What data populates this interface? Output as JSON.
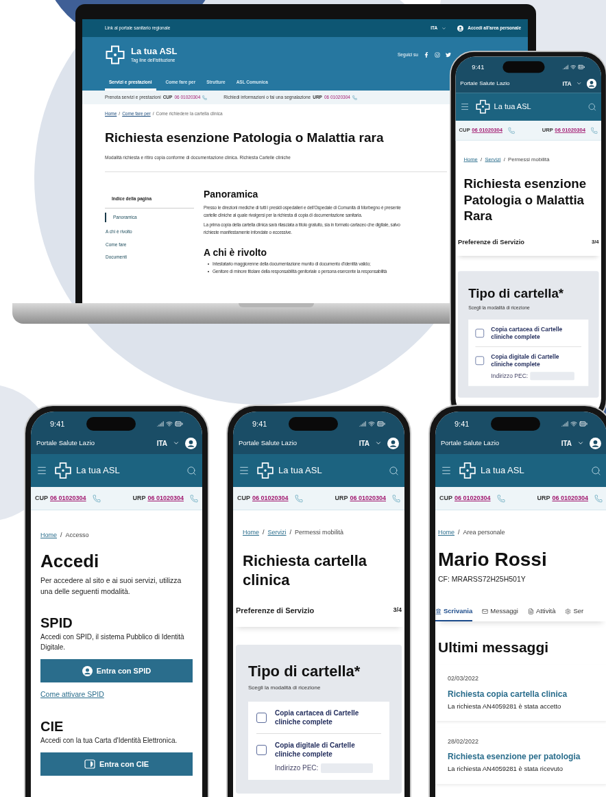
{
  "laptop": {
    "top_bar": {
      "link": "Link al portale sanitario regionale",
      "language": "ITA",
      "login": "Accedi all'area personale"
    },
    "header": {
      "title": "La tua ASL",
      "tagline": "Tag line dell'istituzione",
      "social_label": "Seguici su"
    },
    "nav": [
      {
        "label": "Servizi e prestazioni",
        "selected": true
      },
      {
        "label": "Come fare per",
        "selected": false
      },
      {
        "label": "Strutture",
        "selected": false
      },
      {
        "label": "ASL Comunica",
        "selected": false
      }
    ],
    "contacts": [
      {
        "text": "Prenota servizi e prestazioni",
        "code": "CUP",
        "number": "06 01020304"
      },
      {
        "text": "Richiedi informazioni o fai una segnalazione",
        "code": "URP",
        "number": "06 01020304"
      }
    ],
    "breadcrumb": [
      {
        "label": "Home",
        "link": true
      },
      {
        "separator": "/",
        "label": "Come fare per",
        "link": true
      },
      {
        "separator": "/",
        "label": "Come richiedere la cartella clinica",
        "link": false
      }
    ],
    "title": "Richiesta esenzione Patologia o Malattia rara",
    "subtitle": "Modalità richiesta e ritiro copia conforme di documentazione clinica. Richiesta Cartelle cliniche",
    "index": {
      "title": "Indice della pagina",
      "items": [
        {
          "label": "Panoramica",
          "selected": true
        },
        {
          "label": "A chi è rivolto",
          "selected": false
        },
        {
          "label": "Come fare",
          "selected": false
        },
        {
          "label": "Documenti",
          "selected": false
        }
      ]
    },
    "sections": [
      {
        "title": "Panoramica",
        "paragraphs": [
          [
            "Presso le direzioni mediche di tutti i presidi ospedalieri e dell'Ospedale di Comunità di Morbegno è presente",
            "cartelle cliniche al quale rivolgersi per la richiesta di copia di documentazione sanitaria."
          ],
          [
            "La prima copia della cartella clinica sarà rilasciata a titolo gratuito, sia in formato cartaceo che digitale, salvo",
            "richieste manifestamente infondate o eccessive."
          ]
        ]
      },
      {
        "title": "A chi è rivolto",
        "bullets": [
          "Intestatario maggiorenne della documentazione munito di documento d'identità valido;",
          "Genitore di minore titolare della responsabilità genitoriale o persona esercente la responsabilità"
        ]
      }
    ]
  },
  "phones": [
    {
      "kind": "form",
      "time": "9:41",
      "portal": "Portale Salute Lazio",
      "language": "ITA",
      "brand": "La tua ASL",
      "contacts": [
        {
          "code": "CUP",
          "number": "06 01020304"
        },
        {
          "code": "URP",
          "number": "06 01020304"
        }
      ],
      "breadcrumb": [
        {
          "label": "Home",
          "link": true
        },
        {
          "separator": "/",
          "label": "Servizi",
          "link": true
        },
        {
          "separator": "/",
          "label": "Permessi mobilità",
          "link": false
        }
      ],
      "title": "Richiesta esenzione Patologia o Malattia Rara",
      "step": {
        "label": "Preferenze di Servizio",
        "count": "3/4"
      },
      "card": {
        "title": "Tipo di cartella*",
        "hint": "Scegli la modalità di ricezione",
        "options": [
          {
            "label": "Copia cartacea di Cartelle cliniche complete",
            "checked": false
          },
          {
            "label": "Copia digitale di Cartelle cliniche complete",
            "checked": false,
            "field_label": "Indirizzo PEC:"
          }
        ]
      }
    },
    {
      "kind": "login",
      "time": "9:41",
      "portal": "Portale Salute Lazio",
      "language": "ITA",
      "brand": "La tua ASL",
      "contacts": [
        {
          "code": "CUP",
          "number": "06 01020304"
        },
        {
          "code": "URP",
          "number": "06 01020304"
        }
      ],
      "breadcrumb": [
        {
          "label": "Home",
          "link": true
        },
        {
          "separator": "/",
          "label": "Accesso",
          "link": false
        }
      ],
      "title": "Accedi",
      "intro": "Per accedere al sito e ai suoi servizi, utilizza una delle seguenti modalità.",
      "methods": [
        {
          "title": "SPID",
          "text": "Accedi con SPID, il sistema Pubblico di Identità Digitale.",
          "button": "Entra con SPID",
          "link": "Come attivare SPID"
        },
        {
          "title": "CIE",
          "text": "Accedi con la tua Carta d'Identità Elettronica.",
          "button": "Entra con CIE"
        }
      ]
    },
    {
      "kind": "form",
      "time": "9:41",
      "portal": "Portale Salute Lazio",
      "language": "ITA",
      "brand": "La tua ASL",
      "contacts": [
        {
          "code": "CUP",
          "number": "06 01020304"
        },
        {
          "code": "URP",
          "number": "06 01020304"
        }
      ],
      "breadcrumb": [
        {
          "label": "Home",
          "link": true
        },
        {
          "separator": "/",
          "label": "Servizi",
          "link": true
        },
        {
          "separator": "/",
          "label": "Permessi mobilità",
          "link": false
        }
      ],
      "title": "Richiesta cartella clinica",
      "step": {
        "label": "Preferenze di Servizio",
        "count": "3/4"
      },
      "card": {
        "title": "Tipo di cartella*",
        "hint": "Scegli la modalità di ricezione",
        "options": [
          {
            "label": "Copia cartacea di Cartelle cliniche complete",
            "checked": false
          },
          {
            "label": "Copia digitale di Cartelle cliniche complete",
            "checked": false,
            "field_label": "Indirizzo PEC:"
          }
        ]
      }
    },
    {
      "kind": "profile",
      "time": "9:41",
      "portal": "Portale Salute Lazio",
      "language": "ITA",
      "brand": "La tua ASL",
      "contacts": [
        {
          "code": "CUP",
          "number": "06 01020304"
        },
        {
          "code": "URP",
          "number": "06 01020304"
        }
      ],
      "breadcrumb": [
        {
          "label": "Home",
          "link": true
        },
        {
          "separator": "/",
          "label": "Area personale",
          "link": false
        }
      ],
      "title": "Mario Rossi",
      "cf": "CF: MRARSS72H25H501Y",
      "tabs": [
        {
          "label": "Scrivania",
          "selected": true
        },
        {
          "label": "Messaggi",
          "selected": false
        },
        {
          "label": "Attività",
          "selected": false
        },
        {
          "label": "Ser",
          "selected": false
        }
      ],
      "section": "Ultimi messaggi",
      "messages": [
        {
          "date": "02/03/2022",
          "title": "Richiesta copia cartella clinica",
          "text": "La richiesta AN4059281 è stata accetto"
        },
        {
          "date": "28/02/2022",
          "title": "Richiesta esenzione per patologia",
          "text": "La richiesta AN4059281 è stata ricevuto"
        }
      ]
    }
  ]
}
